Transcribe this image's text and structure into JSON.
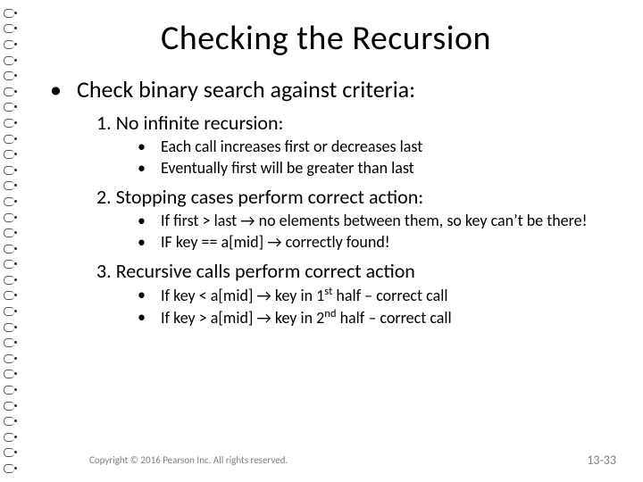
{
  "title": "Checking the Recursion",
  "bullet1": "Check binary search against criteria:",
  "items": [
    {
      "num": "1.",
      "text": "No infinite recursion:",
      "sub": [
        "Each call increases first or decreases last",
        "Eventually first will be greater than last"
      ]
    },
    {
      "num": "2.",
      "text": "Stopping cases perform correct action:",
      "sub": [
        "If first > last → no elements between them, so key can’t be there!",
        "IF key == a[mid] → correctly found!"
      ]
    },
    {
      "num": "3.",
      "text": "Recursive calls perform correct action",
      "sub": [
        "If key < a[mid] → key in 1<sup>st</sup> half – correct call",
        "If key > a[mid] → key in 2<sup>nd</sup> half – correct call"
      ]
    }
  ],
  "copyright": "Copyright © 2016 Pearson Inc. All rights reserved.",
  "page": "13-33"
}
